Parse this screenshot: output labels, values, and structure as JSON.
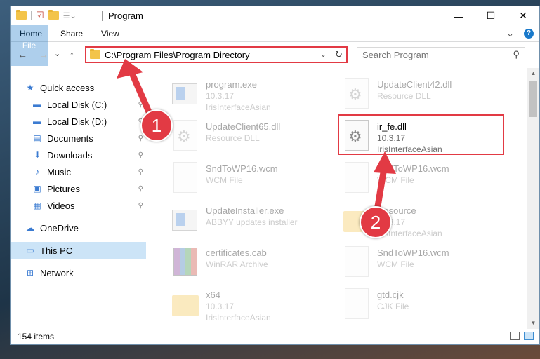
{
  "window": {
    "title": "Program",
    "controls": {
      "minimize": "—",
      "maximize": "☐",
      "close": "✕"
    }
  },
  "ribbon": {
    "tabs": [
      "File",
      "Home",
      "Share",
      "View"
    ],
    "expand": "⌄",
    "help": "?"
  },
  "nav": {
    "back": "←",
    "forward": "→",
    "recent": "⌄",
    "up": "↑",
    "address": "C:\\Program Files\\Program Directory",
    "address_dropdown": "⌄",
    "refresh": "↻",
    "search_placeholder": "Search Program",
    "search_icon": "search-icon"
  },
  "sidebar": {
    "items": [
      {
        "label": "Quick access",
        "icon": "star-icon",
        "glyph": "★",
        "pinned": false
      },
      {
        "label": "Local Disk (C:)",
        "icon": "drive-icon",
        "glyph": "▬",
        "pinned": true
      },
      {
        "label": "Local Disk (D:)",
        "icon": "drive-icon",
        "glyph": "▬",
        "pinned": true
      },
      {
        "label": "Documents",
        "icon": "documents-icon",
        "glyph": "▤",
        "pinned": true
      },
      {
        "label": "Downloads",
        "icon": "downloads-icon",
        "glyph": "⬇",
        "pinned": true
      },
      {
        "label": "Music",
        "icon": "music-icon",
        "glyph": "♪",
        "pinned": true
      },
      {
        "label": "Pictures",
        "icon": "pictures-icon",
        "glyph": "▣",
        "pinned": true
      },
      {
        "label": "Videos",
        "icon": "videos-icon",
        "glyph": "▦",
        "pinned": true
      },
      {
        "label": "OneDrive",
        "icon": "cloud-icon",
        "glyph": "☁",
        "pinned": false
      },
      {
        "label": "This PC",
        "icon": "computer-icon",
        "glyph": "▭",
        "pinned": false
      },
      {
        "label": "Network",
        "icon": "network-icon",
        "glyph": "⊞",
        "pinned": false
      }
    ],
    "pin_glyph": "📌"
  },
  "files": [
    {
      "name": "program.exe",
      "line2": "10.3.17",
      "line3": "IrisInterfaceAsian",
      "icon": "exe"
    },
    {
      "name": "UpdateClient42.dll",
      "line2": "Resource DLL",
      "line3": "",
      "icon": "gear"
    },
    {
      "name": "UpdateClient65.dll",
      "line2": "Resource DLL",
      "line3": "",
      "icon": "gear"
    },
    {
      "name": "ir_fe.dll",
      "line2": "10.3.17",
      "line3": "IrisInterfaceAsian",
      "icon": "gear"
    },
    {
      "name": "SndToWP16.wcm",
      "line2": "WCM File",
      "line3": "",
      "icon": "doc"
    },
    {
      "name": "SndToWP16.wcm",
      "line2": "WCM File",
      "line3": "",
      "icon": "doc"
    },
    {
      "name": "UpdateInstaller.exe",
      "line2": "ABBYY updates installer",
      "line3": "",
      "icon": "exe"
    },
    {
      "name": "Resource",
      "line2": "10.3.17",
      "line3": "IrisInterfaceAsian",
      "icon": "folder"
    },
    {
      "name": "certificates.cab",
      "line2": "WinRAR Archive",
      "line3": "",
      "icon": "rar"
    },
    {
      "name": "SndToWP16.wcm",
      "line2": "WCM File",
      "line3": "",
      "icon": "doc"
    },
    {
      "name": "x64",
      "line2": "10.3.17",
      "line3": "IrisInterfaceAsian",
      "icon": "folder"
    },
    {
      "name": "gtd.cjk",
      "line2": "CJK File",
      "line3": "",
      "icon": "doc"
    }
  ],
  "status": {
    "count": "154 items"
  },
  "annotations": {
    "step1": "1",
    "step2": "2",
    "accent": "#e23a44"
  }
}
